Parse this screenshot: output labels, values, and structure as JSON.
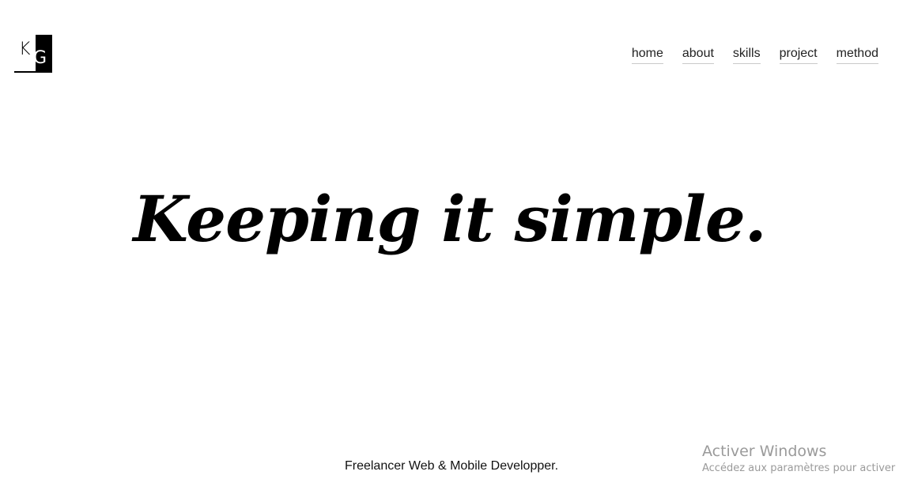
{
  "logo": {
    "letter_1": "K",
    "letter_2": "G"
  },
  "nav": {
    "items": [
      {
        "label": "home"
      },
      {
        "label": "about"
      },
      {
        "label": "skills"
      },
      {
        "label": "project"
      },
      {
        "label": "method"
      }
    ]
  },
  "hero": {
    "headline": "Keeping it simple."
  },
  "subtitle": "Freelancer Web & Mobile Developper.",
  "watermark": {
    "title": "Activer Windows",
    "subtitle": "Accédez aux paramètres pour activer"
  }
}
